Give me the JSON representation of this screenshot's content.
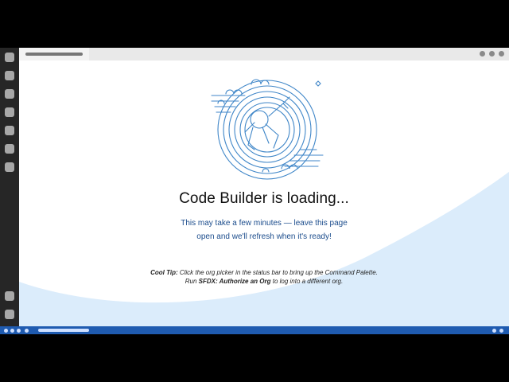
{
  "window": {
    "tab": {
      "icon": "document-icon"
    }
  },
  "loading": {
    "title": "Code Builder is loading...",
    "subtitle_line1": "This may take a few minutes — leave this page",
    "subtitle_line2": "open and we'll refresh when it's ready!",
    "illustration": "astro-swirl-illustration"
  },
  "tip": {
    "label": "Cool Tip:",
    "line1_text": " Click the org picker in the status bar to bring up the Command Palette.",
    "line2_prefix": "Run ",
    "line2_command": "SFDX: Authorize an Org",
    "line2_suffix": " to log into a different org."
  },
  "colors": {
    "accent_blue": "#1f5bb0",
    "illustration_blue": "#3f86c8",
    "wave_light_blue": "#dbecfb",
    "subtitle_blue": "#1b4c8c"
  }
}
